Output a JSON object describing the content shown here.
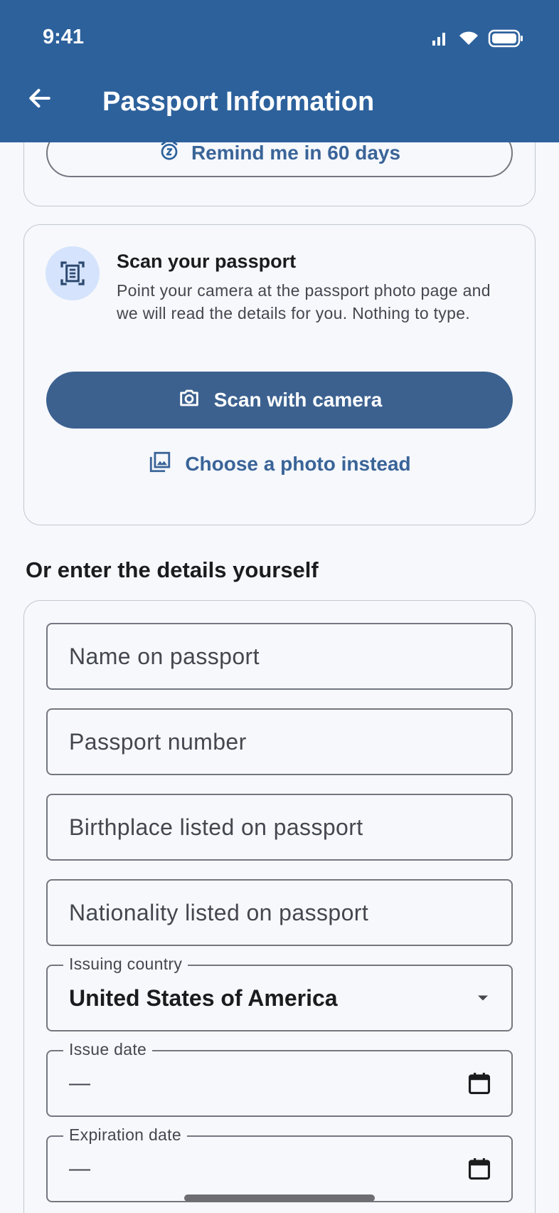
{
  "status_bar": {
    "time": "9:41"
  },
  "header": {
    "title": "Passport Information"
  },
  "reminder": {
    "label": "Remind me in 60 days"
  },
  "scan": {
    "title": "Scan your passport",
    "description": "Point your camera at the passport photo page and we will read the details for you. Nothing to type.",
    "primary_label": "Scan with camera",
    "secondary_label": "Choose a photo instead"
  },
  "manual": {
    "heading": "Or enter the details yourself",
    "name_placeholder": "Name on passport",
    "number_placeholder": "Passport number",
    "birthplace_placeholder": "Birthplace listed on passport",
    "nationality_placeholder": "Nationality listed on passport",
    "issuing_country_label": "Issuing country",
    "issuing_country_value": "United States of America",
    "issue_date_label": "Issue date",
    "issue_date_value": "—",
    "expiration_date_label": "Expiration date",
    "expiration_date_value": "—"
  },
  "colors": {
    "appbar": "#2d619c",
    "primary_button": "#3c618f",
    "link": "#3a6498",
    "background": "#f6f8fc"
  }
}
